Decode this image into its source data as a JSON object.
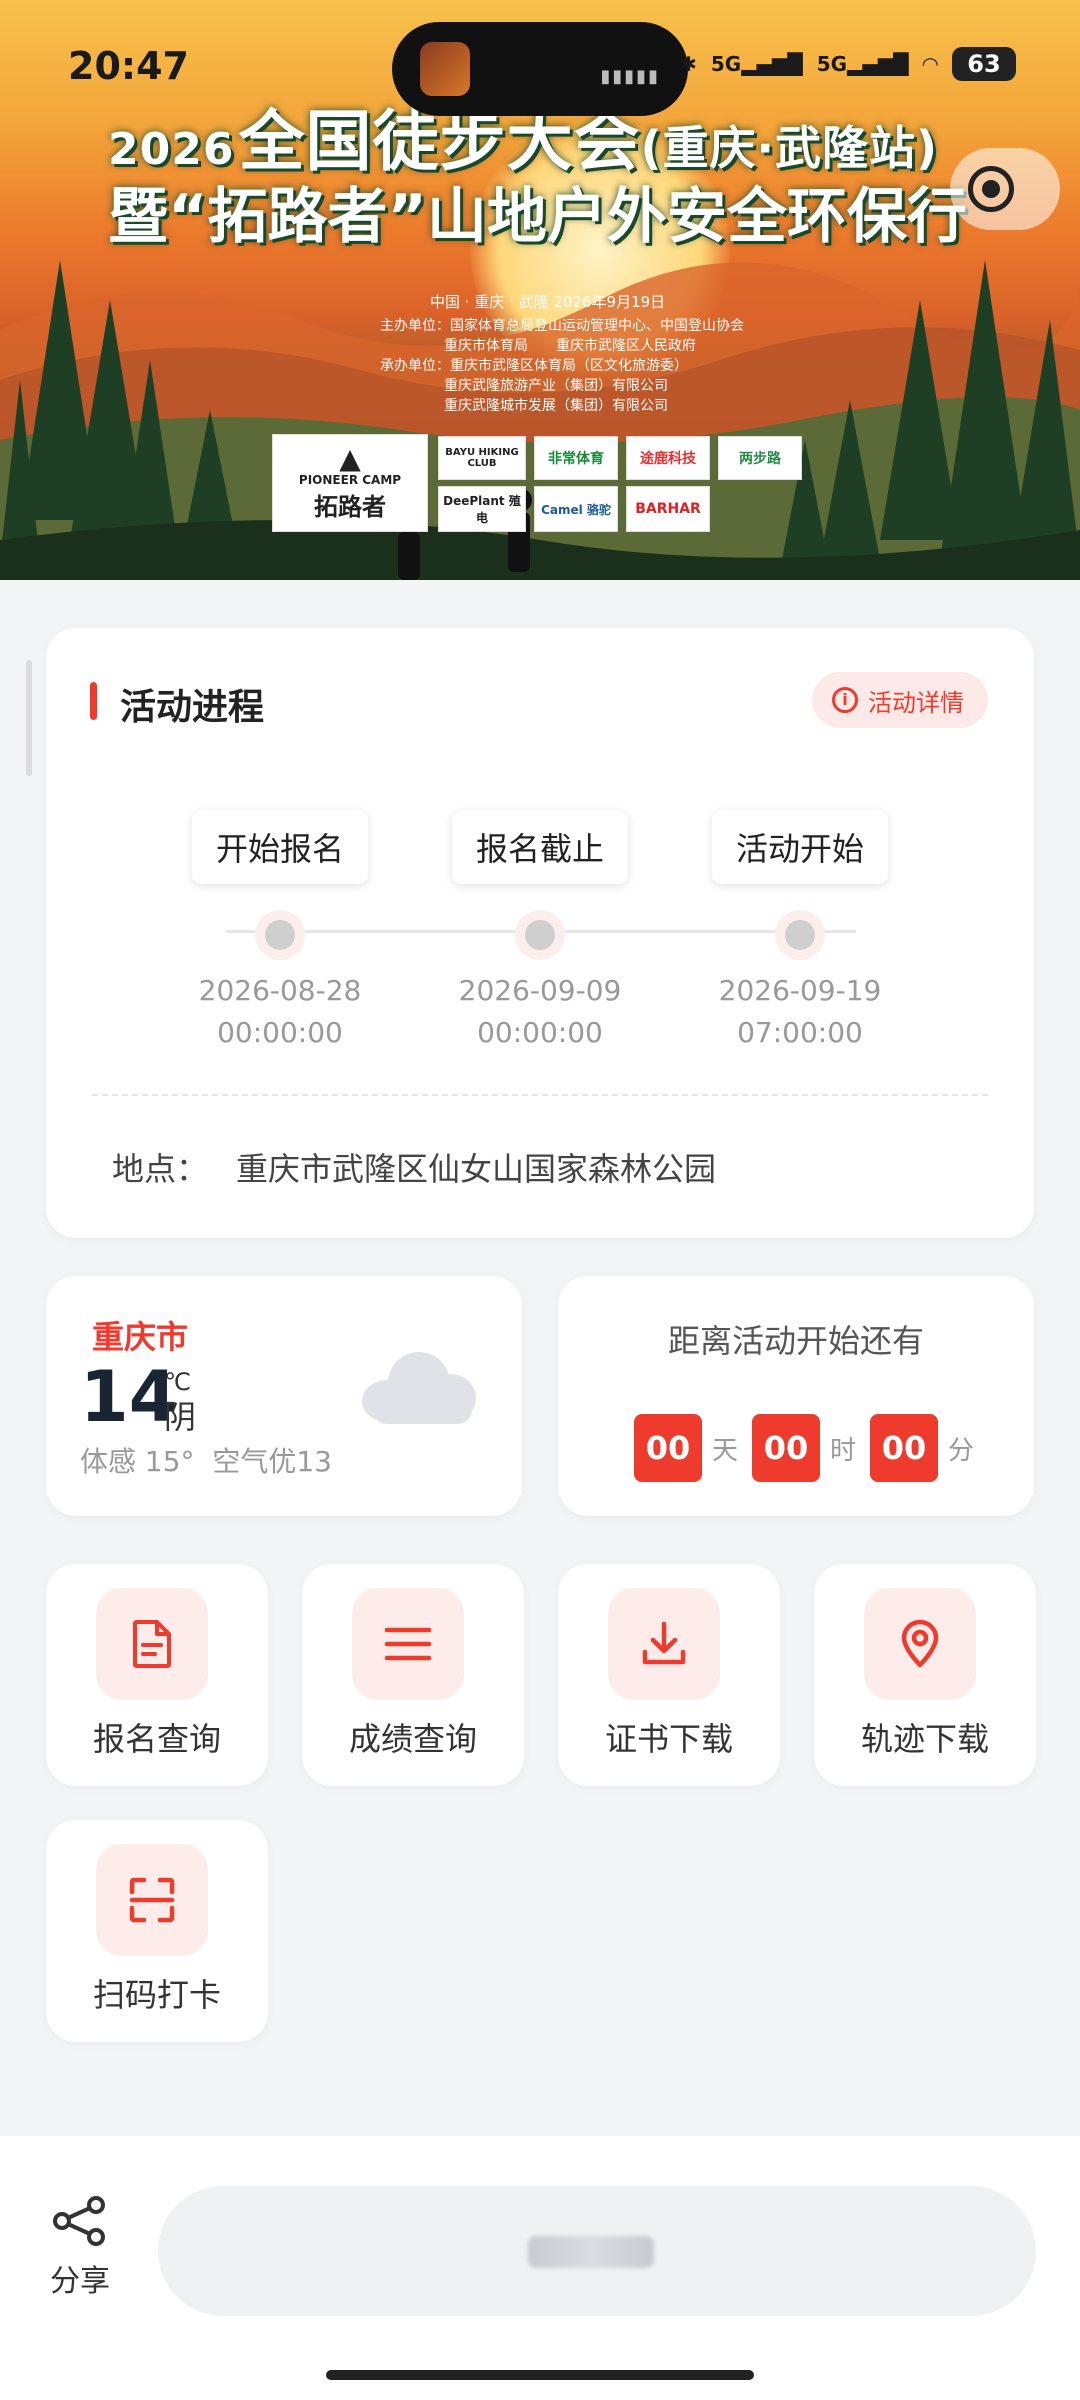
{
  "status_bar": {
    "time": "20:47",
    "network1": "5G",
    "network2": "5G",
    "battery": "63"
  },
  "banner": {
    "year": "2026",
    "title_line1": "全国徒步大会",
    "title_line1_sub": "(重庆·武隆站)",
    "title_line2": "暨“拓路者”山地户外安全环保行",
    "date_line": "中国 · 重庆 · 武隆  2026年9月19日",
    "organizers": [
      "主办单位：国家体育总局登山运动管理中心、中国登山协会",
      "重庆市体育局　　重庆市武隆区人民政府",
      "承办单位：重庆市武隆区体育局（区文化旅游委）",
      "重庆武隆旅游产业（集团）有限公司",
      "重庆武隆城市发展（集团）有限公司"
    ],
    "sponsors": {
      "pioneer_en": "PIONEER CAMP",
      "pioneer_cn": "拓路者",
      "s2": "BAYU HIKING CLUB",
      "s3": "非常体育",
      "s4": "途鹿科技",
      "s5": "两步路",
      "s6": "DeePlant 殖电",
      "s7": "Camel 骆驼",
      "s8": "BARHAR"
    }
  },
  "progress": {
    "title": "活动进程",
    "detail_label": "活动详情",
    "steps": [
      {
        "label": "开始报名",
        "date": "2026-08-28",
        "time": "00:00:00"
      },
      {
        "label": "报名截止",
        "date": "2026-09-09",
        "time": "00:00:00"
      },
      {
        "label": "活动开始",
        "date": "2026-09-19",
        "time": "07:00:00"
      }
    ],
    "location_key": "地点：",
    "location_value": "重庆市武隆区仙女山国家森林公园"
  },
  "weather": {
    "city": "重庆市",
    "temp": "14",
    "unit": "℃",
    "condition": "阴",
    "feels_like": "体感 15°",
    "air": "空气优13",
    "icon": "cloud-icon"
  },
  "countdown": {
    "title": "距离活动开始还有",
    "days": "00",
    "days_unit": "天",
    "hours": "00",
    "hours_unit": "时",
    "minutes": "00",
    "minutes_unit": "分"
  },
  "actions": [
    {
      "label": "报名查询",
      "icon": "document-icon"
    },
    {
      "label": "成绩查询",
      "icon": "list-icon"
    },
    {
      "label": "证书下载",
      "icon": "download-icon"
    },
    {
      "label": "轨迹下载",
      "icon": "location-pin-icon"
    },
    {
      "label": "扫码打卡",
      "icon": "scan-icon"
    }
  ],
  "bottom": {
    "share_label": "分享"
  },
  "colors": {
    "accent": "#ef3b2d",
    "accent_light": "#fdecea",
    "background": "#f3f4f6"
  }
}
